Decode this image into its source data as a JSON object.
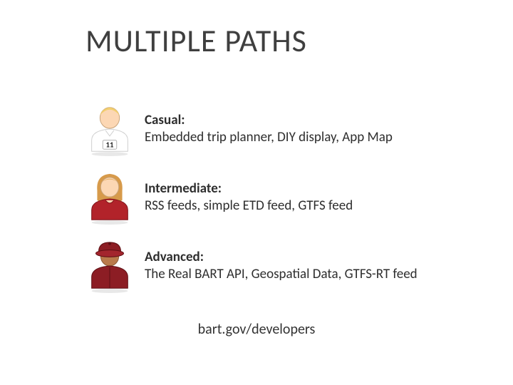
{
  "title": "MULTIPLE PATHS",
  "rows": [
    {
      "label": "Casual:",
      "desc": "Embedded trip planner, DIY display, App Map"
    },
    {
      "label": "Intermediate:",
      "desc": "RSS feeds, simple ETD feed, GTFS feed"
    },
    {
      "label": "Advanced:",
      "desc": "The Real BART API, Geospatial Data, GTFS-RT feed"
    }
  ],
  "footer": "bart.gov/developers"
}
